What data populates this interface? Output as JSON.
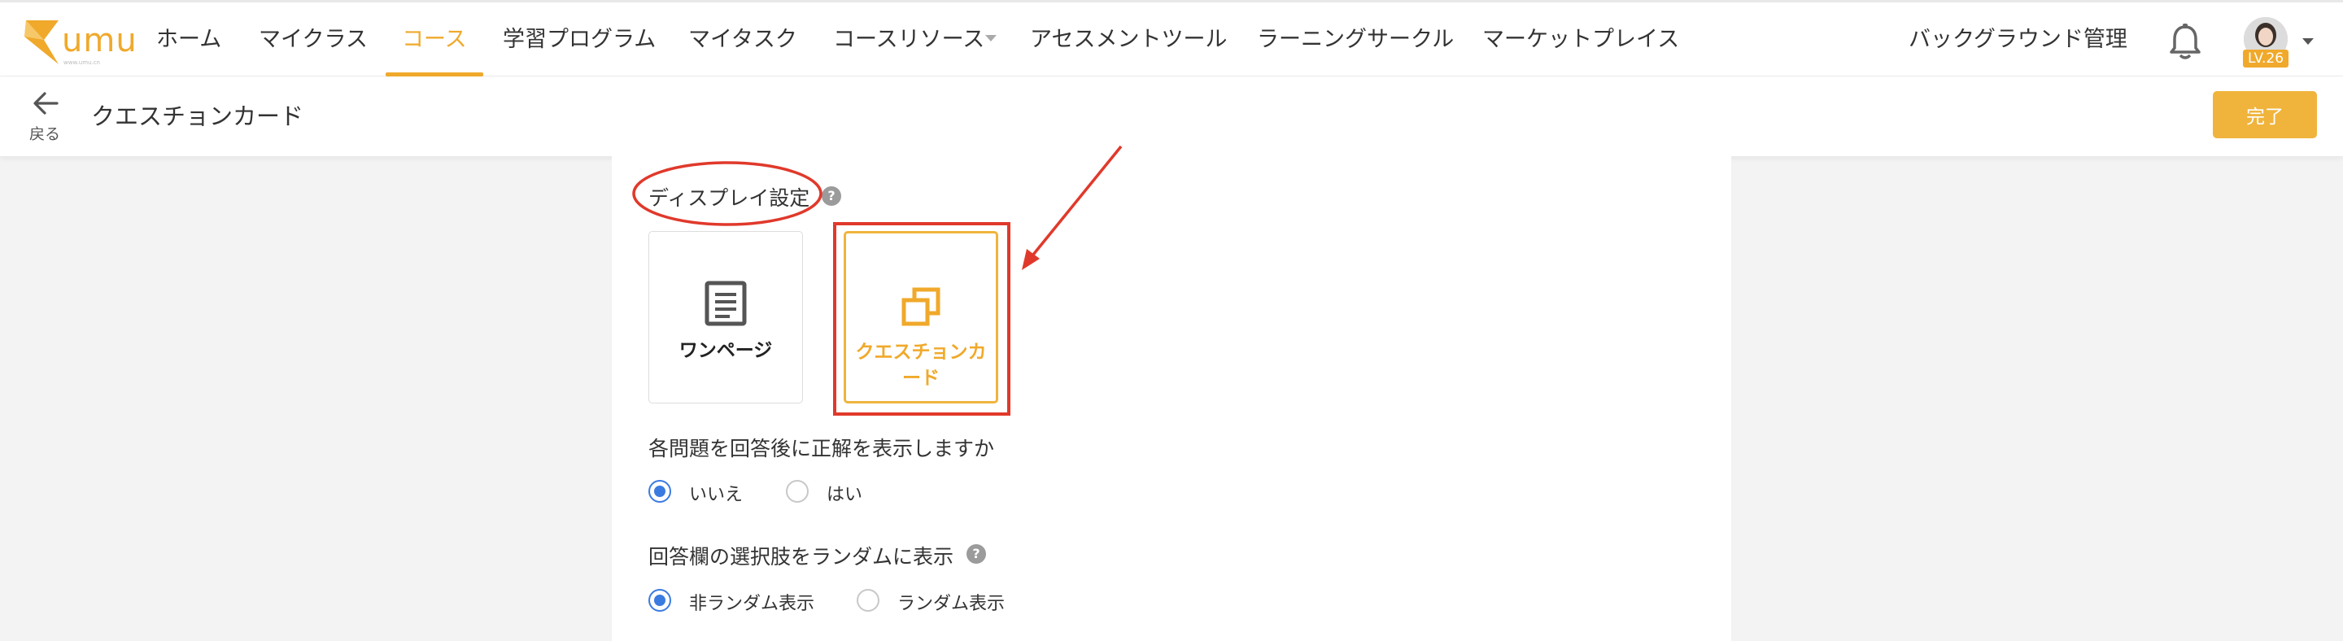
{
  "nav": {
    "logo_text": "umu",
    "logo_sub": "www.umu.cn",
    "items": [
      "ホーム",
      "マイクラス",
      "コース",
      "学習プログラム",
      "マイタスク",
      "コースリソース",
      "アセスメントツール",
      "ラーニングサークル",
      "マーケットプレイス"
    ],
    "active_index": 2,
    "admin_link": "バックグラウンド管理",
    "level_badge": "LV.26"
  },
  "subheader": {
    "back_label": "戻る",
    "title": "クエスチョンカード",
    "done_label": "完了"
  },
  "display_settings": {
    "title": "ディスプレイ設定",
    "help": "?",
    "options": [
      {
        "label": "ワンページ",
        "icon": "document-icon",
        "selected": false
      },
      {
        "label_line1": "クエスチョンカ",
        "label_line2": "ード",
        "icon": "copy-cards-icon",
        "selected": true
      }
    ]
  },
  "show_answer": {
    "question": "各問題を回答後に正解を表示しますか",
    "options": [
      "いいえ",
      "はい"
    ],
    "selected": "いいえ"
  },
  "random_choices": {
    "question": "回答欄の選択肢をランダムに表示",
    "help": "?",
    "options": [
      "非ランダム表示",
      "ランダム表示"
    ],
    "selected": "非ランダム表示"
  },
  "colors": {
    "accent": "#f0a92b",
    "radio": "#3a7be0",
    "annotation": "#e0392b"
  }
}
